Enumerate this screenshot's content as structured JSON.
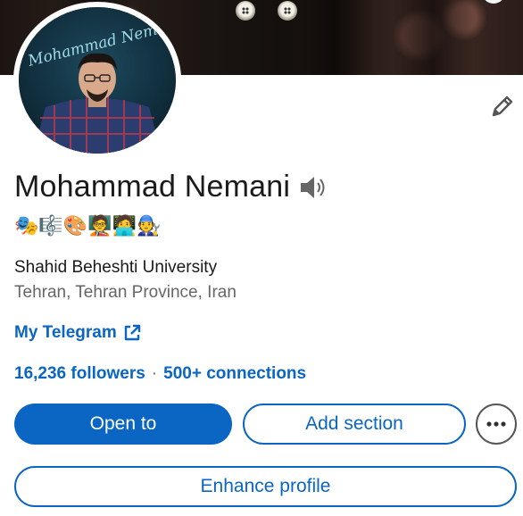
{
  "profile": {
    "name": "Mohammad Nemani",
    "emojis": "🎭🎼🎨🧑‍🏫🧑‍💻🧑‍🔧",
    "headline": "Shahid Beheshti University",
    "location": "Tehran, Tehran Province, Iran",
    "avatar_signature": "Mohammad Nemani"
  },
  "link": {
    "label": "My Telegram"
  },
  "stats": {
    "followers": "16,236 followers",
    "separator": "·",
    "connections": "500+ connections"
  },
  "actions": {
    "open_to": "Open to",
    "add_section": "Add section",
    "enhance_profile": "Enhance profile"
  },
  "icons": {
    "edit": "pencil-icon",
    "pronunciation": "speaker-icon",
    "external_link": "external-link-icon",
    "more": "more-options-icon"
  },
  "colors": {
    "accent": "#0a66c2",
    "text_primary": "#1a1a1a",
    "text_secondary": "#666666"
  }
}
